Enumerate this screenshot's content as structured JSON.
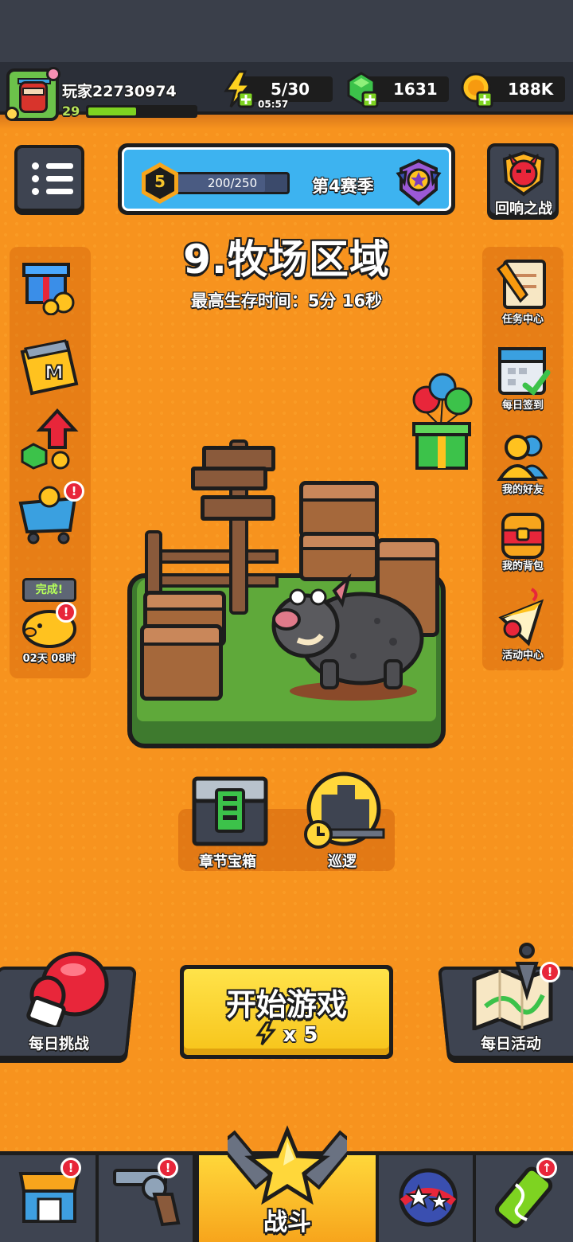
{
  "player": {
    "name": "玩家22730974",
    "level": "29",
    "xp_progress": 0.45
  },
  "resources": {
    "energy": {
      "value": "5/30",
      "timer": "05:57",
      "icon": "lightning-plus-icon"
    },
    "gems": {
      "value": "1631",
      "icon": "green-gem-plus-icon"
    },
    "coins": {
      "value": "188K",
      "icon": "gold-coin-plus-icon"
    }
  },
  "season": {
    "level": "5",
    "progress_text": "200/250",
    "progress": 0.8,
    "name": "第4赛季"
  },
  "echo_battle": {
    "label": "回响之战"
  },
  "stage": {
    "title": "9.牧场区域",
    "best_survival": "最高生存时间：5分 16秒"
  },
  "left_sidebar": {
    "items": [
      {
        "icon": "gift-coins-icon"
      },
      {
        "icon": "m-card-icon"
      },
      {
        "icon": "gem-upgrade-icon"
      },
      {
        "icon": "shop-cart-icon",
        "badge": "!"
      },
      {
        "icon": "piggy-bank-icon",
        "tag": "完成!",
        "badge": "!",
        "timer": "02天 08时"
      }
    ]
  },
  "right_sidebar": {
    "items": [
      {
        "label": "任务中心",
        "icon": "quest-scroll-icon"
      },
      {
        "label": "每日签到",
        "icon": "calendar-check-icon"
      },
      {
        "label": "我的好友",
        "icon": "friends-icon"
      },
      {
        "label": "我的背包",
        "icon": "backpack-icon"
      },
      {
        "label": "活动中心",
        "icon": "party-popper-icon"
      }
    ]
  },
  "chapter_buttons": {
    "chest": {
      "label": "章节宝箱"
    },
    "patrol": {
      "label": "巡逻"
    }
  },
  "bottom": {
    "daily_challenge": {
      "label": "每日挑战"
    },
    "start": {
      "title": "开始游戏",
      "cost": "x 5"
    },
    "daily_activity": {
      "label": "每日活动",
      "badge": "!"
    }
  },
  "navbar": {
    "tabs": [
      {
        "icon": "shop-icon",
        "badge": "!"
      },
      {
        "icon": "revolver-icon",
        "badge": "!"
      },
      {
        "label": "战斗",
        "icon": "star-battle-icon",
        "active": true
      },
      {
        "icon": "stars-orb-icon"
      },
      {
        "icon": "dna-tube-icon",
        "badge": "↑"
      }
    ]
  },
  "colors": {
    "background": "#f7931e",
    "panel": "#3e4451",
    "accent_yellow": "#f7c41a",
    "badge_red": "#e8263a"
  }
}
